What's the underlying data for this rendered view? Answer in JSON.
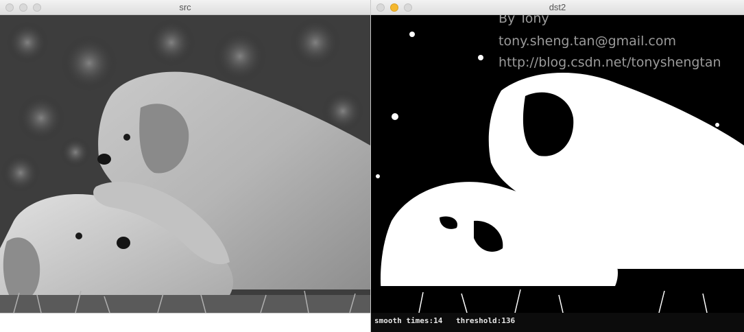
{
  "windows": {
    "src": {
      "title": "src"
    },
    "dst": {
      "title": "dst2"
    }
  },
  "overlay": {
    "author": "By Tony",
    "email": "tony.sheng.tan@gmail.com",
    "url": "http://blog.csdn.net/tonyshengtan"
  },
  "trackbars": {
    "smooth": "smooth times:14",
    "threshold": "threshold:136"
  },
  "colors": {
    "titlebar": "#e2e2e2",
    "minimize_active": "#f5b82e",
    "overlay_text": "#9a9a9a",
    "binary_fg": "#ffffff",
    "binary_bg": "#000000"
  }
}
